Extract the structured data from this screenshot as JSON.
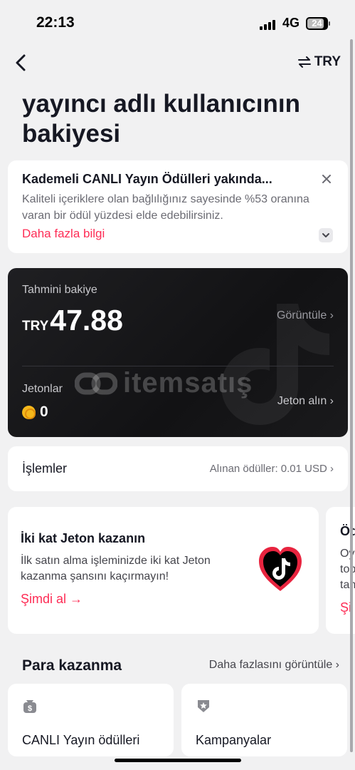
{
  "status_bar": {
    "time": "22:13",
    "network": "4G",
    "battery": "24"
  },
  "header": {
    "currency": "TRY"
  },
  "title": "yayıncı adlı kullanıcının bakiyesi",
  "notice": {
    "title": "Kademeli CANLI Yayın Ödülleri yakında...",
    "text": "Kaliteli içeriklere olan bağlılığınız sayesinde %53 oranına varan bir ödül yüzdesi elde edebilirsiniz.",
    "link": "Daha fazla bilgi"
  },
  "balance": {
    "label": "Tahmini bakiye",
    "currency": "TRY",
    "amount": "47.88",
    "view_label": "Görüntüle ›",
    "coins_label": "Jetonlar",
    "coins_value": "0",
    "get_coins_label": "Jeton alın ›",
    "watermark": "itemsatış"
  },
  "transactions": {
    "label": "İşlemler",
    "value": "Alınan ödüller: 0.01 USD ›"
  },
  "promo": {
    "title": "İki kat Jeton kazanın",
    "text": "İlk satın alma işleminizde iki kat Jeton kazanma şansını kaçırmayın!",
    "link": "Şimdi al →"
  },
  "promo2": {
    "title": "Öd",
    "line1": "Oy",
    "line2": "top",
    "line3": "tan",
    "link": "Şi"
  },
  "monetize": {
    "title": "Para kazanma",
    "more": "Daha fazlasını görüntüle ›",
    "items": [
      {
        "label": "CANLI Yayın ödülleri",
        "icon": "money-bag-icon"
      },
      {
        "label": "Kampanyalar",
        "icon": "badge-star-icon"
      }
    ]
  },
  "colors": {
    "accent": "#fe2c55",
    "card_dark": "#1a1a1c",
    "background": "#f1f1f2"
  }
}
